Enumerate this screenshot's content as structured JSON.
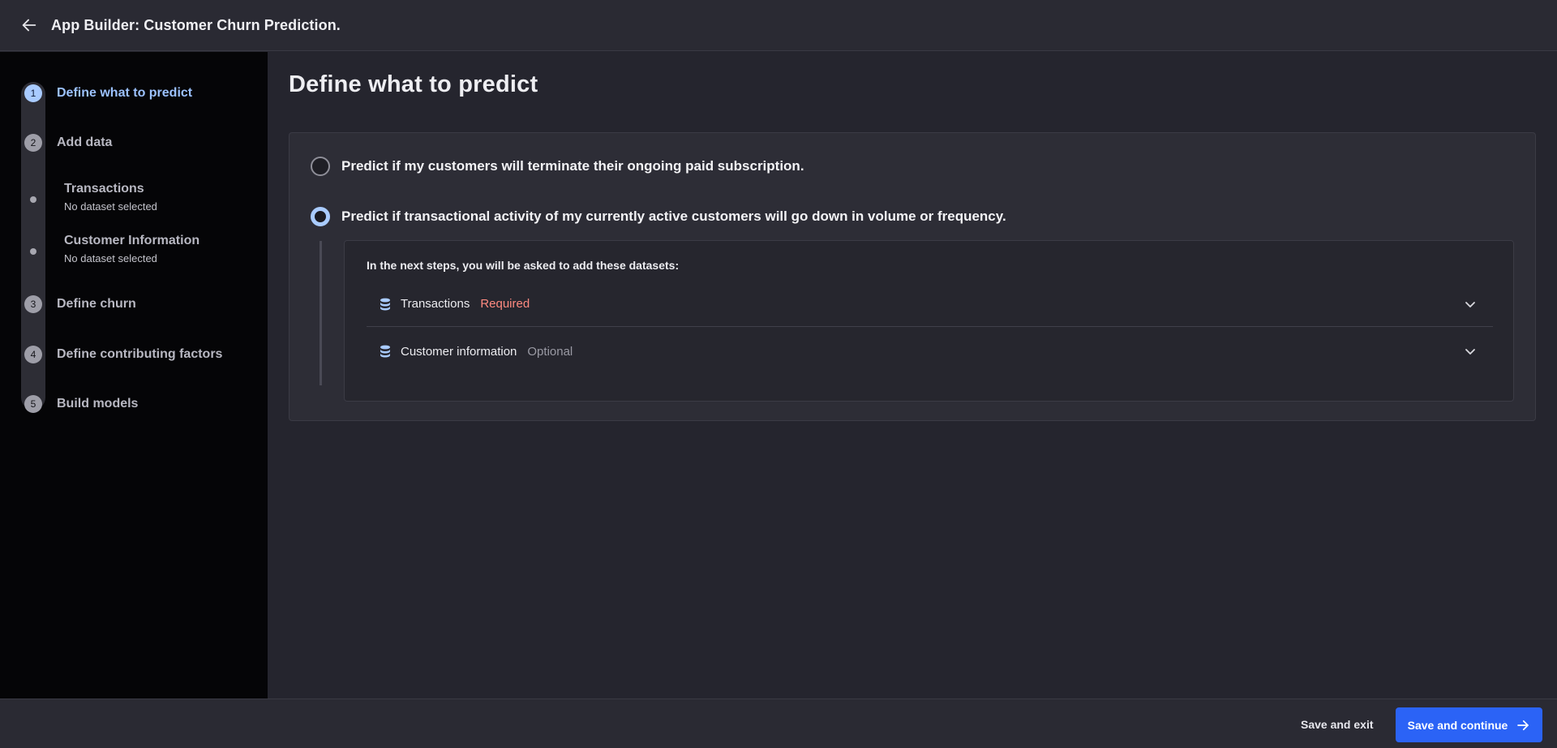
{
  "header": {
    "title": "App Builder: Customer Churn Prediction."
  },
  "sidebar": {
    "steps": [
      {
        "number": "1",
        "label": "Define what to predict"
      },
      {
        "number": "2",
        "label": "Add data"
      },
      {
        "number": "3",
        "label": "Define churn"
      },
      {
        "number": "4",
        "label": "Define contributing factors"
      },
      {
        "number": "5",
        "label": "Build models"
      }
    ],
    "substeps": [
      {
        "title": "Transactions",
        "subtitle": "No dataset selected"
      },
      {
        "title": "Customer Information",
        "subtitle": "No dataset selected"
      }
    ]
  },
  "main": {
    "title": "Define what to predict",
    "options": [
      {
        "label": "Predict if my customers will terminate their ongoing paid subscription.",
        "selected": false
      },
      {
        "label": "Predict if transactional activity of my currently active customers will go down in volume or frequency.",
        "selected": true
      }
    ],
    "datasets_heading": "In the next steps, you will be asked to add these datasets:",
    "datasets": [
      {
        "name": "Transactions",
        "tag": "Required"
      },
      {
        "name": "Customer information",
        "tag": "Optional"
      }
    ]
  },
  "footer": {
    "save_exit_label": "Save and exit",
    "save_continue_label": "Save and continue"
  },
  "colors": {
    "accent": "#a9cbff",
    "primary_button": "#2b63f6",
    "required": "#ff8a80"
  }
}
